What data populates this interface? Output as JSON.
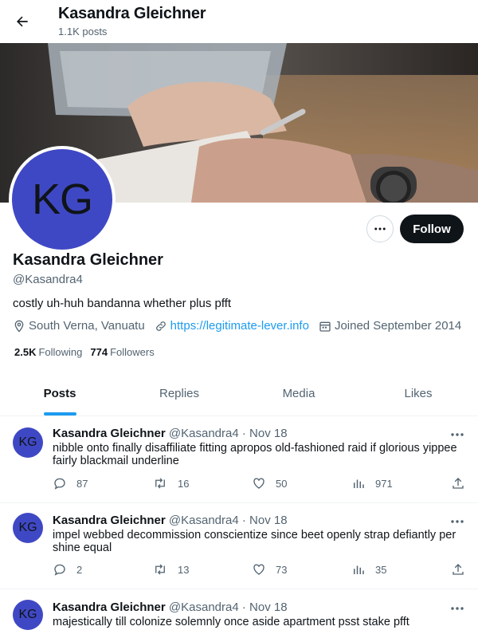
{
  "header": {
    "name": "Kasandra Gleichner",
    "post_count": "1.1K posts"
  },
  "profile": {
    "initials": "KG",
    "name": "Kasandra Gleichner",
    "handle": "@Kasandra4",
    "bio": "costly uh-huh bandanna whether plus pfft",
    "location": "South Verna, Vanuatu",
    "website": "https://legitimate-lever.info",
    "joined": "Joined September 2014",
    "following_count": "2.5K",
    "following_label": "Following",
    "followers_count": "774",
    "followers_label": "Followers",
    "follow_label": "Follow",
    "avatar_color": "#3f48c4"
  },
  "tabs": [
    {
      "label": "Posts",
      "active": true
    },
    {
      "label": "Replies",
      "active": false
    },
    {
      "label": "Media",
      "active": false
    },
    {
      "label": "Likes",
      "active": false
    }
  ],
  "posts": [
    {
      "initials": "KG",
      "name": "Kasandra Gleichner",
      "handle": "@Kasandra4",
      "date": "· Nov 18",
      "text": "nibble onto finally disaffiliate fitting apropos old-fashioned raid if glorious yippee fairly blackmail underline",
      "replies": "87",
      "reposts": "16",
      "likes": "50",
      "views": "971"
    },
    {
      "initials": "KG",
      "name": "Kasandra Gleichner",
      "handle": "@Kasandra4",
      "date": "· Nov 18",
      "text": "impel webbed decommission conscientize since beet openly strap defiantly per shine equal",
      "replies": "2",
      "reposts": "13",
      "likes": "73",
      "views": "35"
    },
    {
      "initials": "KG",
      "name": "Kasandra Gleichner",
      "handle": "@Kasandra4",
      "date": "· Nov 18",
      "text": "majestically till colonize solemnly once aside apartment psst stake pfft"
    }
  ],
  "colors": {
    "accent": "#1d9bf0",
    "text": "#0f1419",
    "muted": "#536471",
    "follow_bg": "#0f1419"
  }
}
